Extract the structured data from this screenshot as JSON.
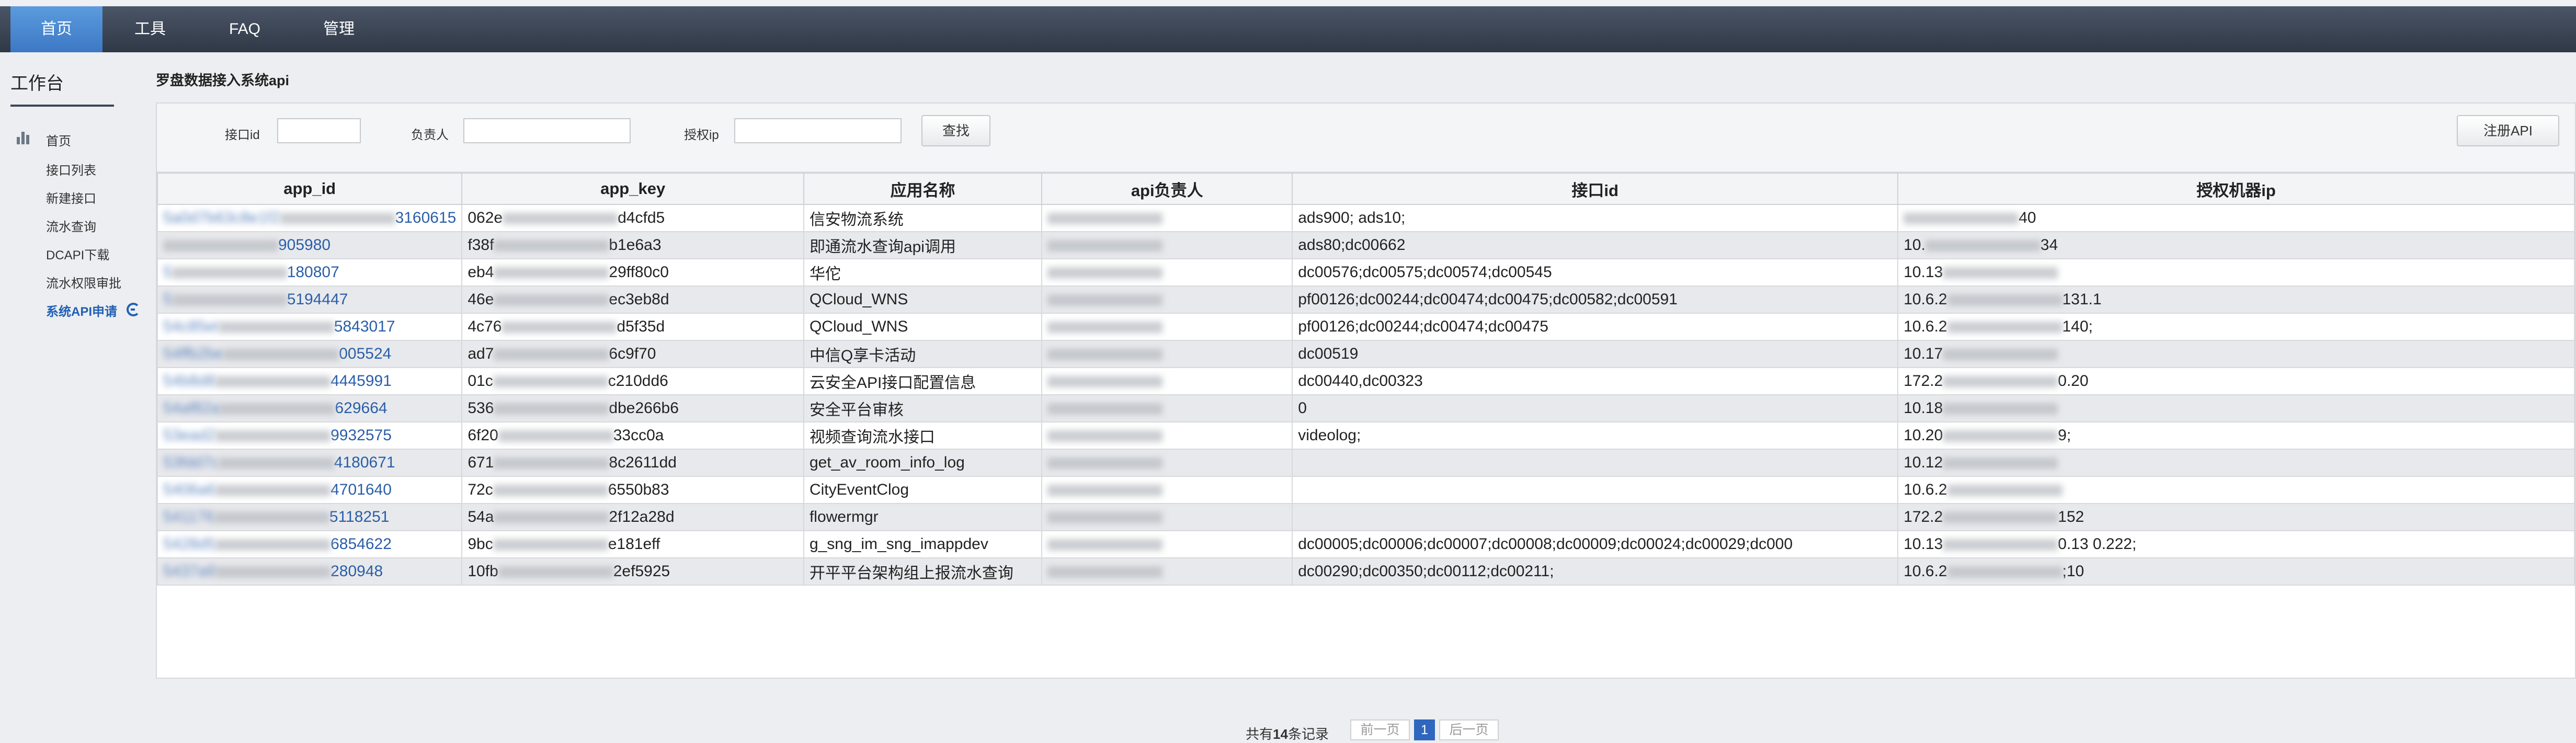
{
  "nav": {
    "tabs": [
      {
        "label": "首页",
        "active": true
      },
      {
        "label": "工具",
        "active": false
      },
      {
        "label": "FAQ",
        "active": false
      },
      {
        "label": "管理",
        "active": false
      }
    ]
  },
  "sidebar": {
    "title": "工作台",
    "items": [
      {
        "label": "首页"
      },
      {
        "label": "接口列表"
      },
      {
        "label": "新建接口"
      },
      {
        "label": "流水查询"
      },
      {
        "label": "DCAPI下载"
      },
      {
        "label": "流水权限审批"
      },
      {
        "label": "系统API申请",
        "active": true
      }
    ]
  },
  "main": {
    "heading": "罗盘数据接入系统api",
    "filters": {
      "interface_id_label": "接口id",
      "owner_label": "负责人",
      "auth_ip_label": "授权ip",
      "search_button": "查找",
      "register_button": "注册API"
    },
    "table": {
      "columns": [
        "app_id",
        "app_key",
        "应用名称",
        "api负责人",
        "接口id",
        "授权机器ip"
      ],
      "rows": [
        {
          "app_id_pre": "5a0d7b63c8e1f2",
          "app_id_suf": "3160615",
          "app_key_pre": "062e",
          "app_key_suf": "d4cfd5",
          "app_name": "信安物流系统",
          "owner": "",
          "interface_ids": "ads900; ads10;",
          "ip_pre": "",
          "ip_suf": "40"
        },
        {
          "app_id_pre": "",
          "app_id_suf": "905980",
          "app_key_pre": "f38f",
          "app_key_suf": "b1e6a3",
          "app_name": "即通流水查询api调用",
          "owner": "",
          "interface_ids": "ads80;dc00662",
          "ip_pre": "10.",
          "ip_suf": "34"
        },
        {
          "app_id_pre": "5",
          "app_id_suf": "180807",
          "app_key_pre": "eb4",
          "app_key_suf": "29ff80c0",
          "app_name": "华佗",
          "owner": "",
          "interface_ids": "dc00576;dc00575;dc00574;dc00545",
          "ip_pre": "10.13",
          "ip_suf": ""
        },
        {
          "app_id_pre": "5",
          "app_id_suf": "5194447",
          "app_key_pre": "46e",
          "app_key_suf": "ec3eb8d",
          "app_name": "QCloud_WNS",
          "owner": "",
          "interface_ids": "pf00126;dc00244;dc00474;dc00475;dc00582;dc00591",
          "ip_pre": "10.6.2",
          "ip_suf": "131.1"
        },
        {
          "app_id_pre": "54c85et",
          "app_id_suf": "5843017",
          "app_key_pre": "4c76",
          "app_key_suf": "d5f35d",
          "app_name": "QCloud_WNS",
          "owner": "",
          "interface_ids": "pf00126;dc00244;dc00474;dc00475",
          "ip_pre": "10.6.2",
          "ip_suf": "140;"
        },
        {
          "app_id_pre": "54ffb2be",
          "app_id_suf": "005524",
          "app_key_pre": "ad7",
          "app_key_suf": "6c9f70",
          "app_name": "中信Q享卡活动",
          "owner": "",
          "interface_ids": "dc00519",
          "ip_pre": "10.17",
          "ip_suf": ""
        },
        {
          "app_id_pre": "54b8d8",
          "app_id_suf": "4445991",
          "app_key_pre": "01c",
          "app_key_suf": "c210dd6",
          "app_name": "云安全API接口配置信息",
          "owner": "",
          "interface_ids": "dc00440,dc00323",
          "ip_pre": "172.2",
          "ip_suf": "0.20"
        },
        {
          "app_id_pre": "54af82a",
          "app_id_suf": "629664",
          "app_key_pre": "536",
          "app_key_suf": "dbe266b6",
          "app_name": "安全平台审核",
          "owner": "",
          "interface_ids": "0",
          "ip_pre": "10.18",
          "ip_suf": ""
        },
        {
          "app_id_pre": "53ead2",
          "app_id_suf": "9932575",
          "app_key_pre": "6f20",
          "app_key_suf": "33cc0a",
          "app_name": "视频查询流水接口",
          "owner": "",
          "interface_ids": "videolog;",
          "ip_pre": "10.20",
          "ip_suf": "9;"
        },
        {
          "app_id_pre": "53fdd7c",
          "app_id_suf": "4180671",
          "app_key_pre": "671",
          "app_key_suf": "8c2611dd",
          "app_name": "get_av_room_info_log",
          "owner": "",
          "interface_ids": "",
          "ip_pre": "10.12",
          "ip_suf": ""
        },
        {
          "app_id_pre": "5406a6",
          "app_id_suf": "4701640",
          "app_key_pre": "72c",
          "app_key_suf": "6550b83",
          "app_name": "CityEventClog",
          "owner": "",
          "interface_ids": "",
          "ip_pre": "10.6.2",
          "ip_suf": ""
        },
        {
          "app_id_pre": "541176",
          "app_id_suf": "5118251",
          "app_key_pre": "54a",
          "app_key_suf": "2f12a28d",
          "app_name": "flowermgr",
          "owner": "",
          "interface_ids": "",
          "ip_pre": "172.2",
          "ip_suf": "152"
        },
        {
          "app_id_pre": "5428d5",
          "app_id_suf": "6854622",
          "app_key_pre": "9bc",
          "app_key_suf": "e181eff",
          "app_name": "g_sng_im_sng_imappdev",
          "owner": "",
          "interface_ids": "dc00005;dc00006;dc00007;dc00008;dc00009;dc00024;dc00029;dc000",
          "ip_pre": "10.13",
          "ip_suf": "0.13    0.222;"
        },
        {
          "app_id_pre": "5437a9",
          "app_id_suf": "280948",
          "app_key_pre": "10fb",
          "app_key_suf": "2ef5925",
          "app_name": "开平平台架构组上报流水查询",
          "owner": "",
          "interface_ids": "dc00290;dc00350;dc00112;dc00211;",
          "ip_pre": "10.6.2",
          "ip_suf": ";10"
        }
      ]
    },
    "pagination": {
      "total_prefix": "共有",
      "total_count": "14",
      "total_suffix": "条记录",
      "prev_label": "前一页",
      "current_page": "1",
      "next_label": "后一页"
    }
  }
}
